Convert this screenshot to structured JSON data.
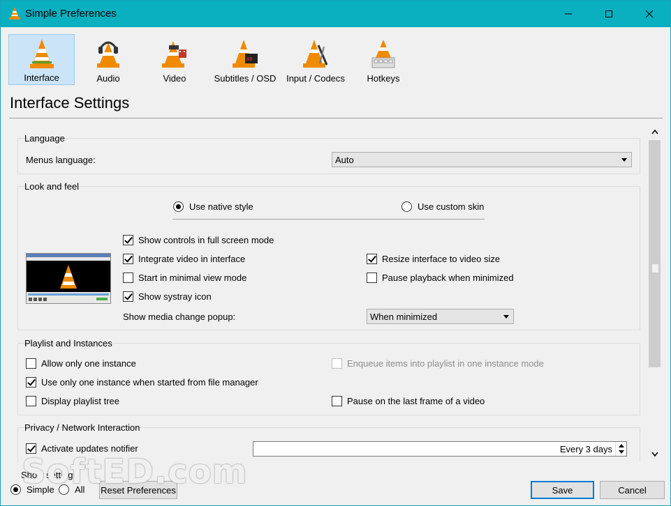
{
  "window": {
    "title": "Simple Preferences"
  },
  "categories": [
    {
      "label": "Interface"
    },
    {
      "label": "Audio"
    },
    {
      "label": "Video"
    },
    {
      "label": "Subtitles / OSD"
    },
    {
      "label": "Input / Codecs"
    },
    {
      "label": "Hotkeys"
    }
  ],
  "page_title": "Interface Settings",
  "language": {
    "group_label": "Language",
    "menus_label": "Menus language:",
    "menus_value": "Auto"
  },
  "look": {
    "group_label": "Look and feel",
    "native_style": "Use native style",
    "custom_skin": "Use custom skin",
    "show_controls": "Show controls in full screen mode",
    "integrate_video": "Integrate video in interface",
    "minimal_view": "Start in minimal view mode",
    "systray": "Show systray icon",
    "resize_interface": "Resize interface to video size",
    "pause_minimized": "Pause playback when minimized",
    "popup_label": "Show media change popup:",
    "popup_value": "When minimized"
  },
  "playlist": {
    "group_label": "Playlist and Instances",
    "one_instance": "Allow only one instance",
    "enqueue": "Enqueue items into playlist in one instance mode",
    "file_manager": "Use only one instance when started from file manager",
    "playlist_tree": "Display playlist tree",
    "pause_last_frame": "Pause on the last frame of a video"
  },
  "privacy": {
    "group_label": "Privacy / Network Interaction",
    "updates": "Activate updates notifier",
    "updates_interval": "Every 3 days"
  },
  "bottom": {
    "show_settings": "Show settings",
    "simple": "Simple",
    "all": "All",
    "reset": "Reset Preferences",
    "save": "Save",
    "cancel": "Cancel"
  },
  "watermark": "SoftED.com",
  "colors": {
    "titlebar": "#0aafc0",
    "accent": "#0078d7",
    "cone_orange": "#f08a00"
  }
}
